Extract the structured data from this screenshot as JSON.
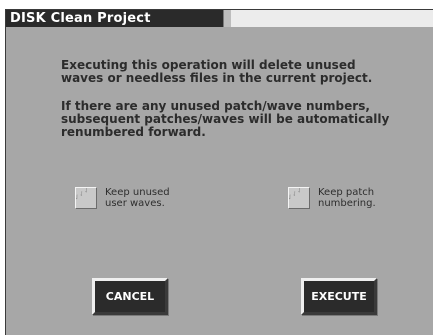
{
  "window": {
    "title": "DISK Clean Project"
  },
  "message": {
    "paragraph1": [
      "Executing this operation will delete unused",
      "waves or needless files in the current project."
    ],
    "paragraph2": [
      "If there are any unused patch/wave numbers,",
      "subsequent patches/waves will be automatically",
      "renumbered forward."
    ]
  },
  "options": [
    {
      "lines": [
        "Keep unused",
        "user waves."
      ],
      "checked": false,
      "icon": "checkbox-icon"
    },
    {
      "lines": [
        "Keep patch",
        "numbering."
      ],
      "checked": false,
      "icon": "checkbox-icon"
    }
  ],
  "buttons": {
    "cancel": "CANCEL",
    "execute": "EXECUTE"
  },
  "colors": {
    "panel": "#a7a7a7",
    "title_bg": "#2a2a2a",
    "button_bg": "#2b2b2b",
    "text": "#2c2c2c"
  }
}
